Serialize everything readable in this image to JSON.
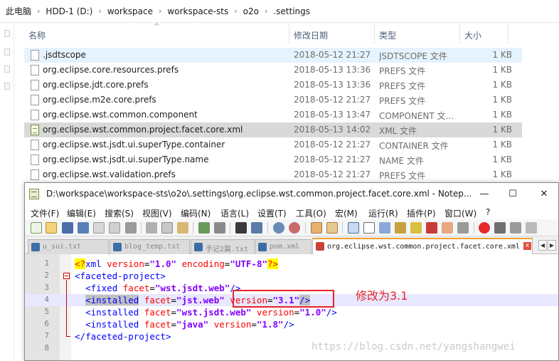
{
  "explorer": {
    "breadcrumb": [
      "此电脑",
      "HDD-1 (D:)",
      "workspace",
      "workspace-sts",
      "o2o",
      ".settings"
    ],
    "columns": {
      "name": "名称",
      "date": "修改日期",
      "type": "类型",
      "size": "大小"
    },
    "files": [
      {
        "name": ".jsdtscope",
        "date": "2018-05-12 21:27",
        "type": "JSDTSCOPE 文件",
        "size": "1 KB"
      },
      {
        "name": "org.eclipse.core.resources.prefs",
        "date": "2018-05-13 13:36",
        "type": "PREFS 文件",
        "size": "1 KB"
      },
      {
        "name": "org.eclipse.jdt.core.prefs",
        "date": "2018-05-13 13:36",
        "type": "PREFS 文件",
        "size": "1 KB"
      },
      {
        "name": "org.eclipse.m2e.core.prefs",
        "date": "2018-05-12 21:27",
        "type": "PREFS 文件",
        "size": "1 KB"
      },
      {
        "name": "org.eclipse.wst.common.component",
        "date": "2018-05-13 13:47",
        "type": "COMPONENT 文...",
        "size": "1 KB"
      },
      {
        "name": "org.eclipse.wst.common.project.facet.core.xml",
        "date": "2018-05-13 14:02",
        "type": "XML 文件",
        "size": "1 KB"
      },
      {
        "name": "org.eclipse.wst.jsdt.ui.superType.container",
        "date": "2018-05-12 21:27",
        "type": "CONTAINER 文件",
        "size": "1 KB"
      },
      {
        "name": "org.eclipse.wst.jsdt.ui.superType.name",
        "date": "2018-05-12 21:27",
        "type": "NAME 文件",
        "size": "1 KB"
      },
      {
        "name": "org.eclipse.wst.validation.prefs",
        "date": "2018-05-12 21:27",
        "type": "PREFS 文件",
        "size": "1 KB"
      }
    ]
  },
  "notepad": {
    "title": "D:\\workspace\\workspace-sts\\o2o\\.settings\\org.eclipse.wst.common.project.facet.core.xml - Notep...",
    "window_buttons": {
      "minimize": "—",
      "maximize": "☐",
      "close": "✕"
    },
    "menu": [
      "文件(F)",
      "编辑(E)",
      "搜索(S)",
      "视图(V)",
      "编码(N)",
      "语言(L)",
      "设置(T)",
      "工具(O)",
      "宏(M)",
      "运行(R)",
      "插件(P)",
      "窗口(W)",
      "?"
    ],
    "tabs": [
      {
        "label": "u_sui.txt",
        "active": false
      },
      {
        "label": "blog_temp.txt",
        "active": false
      },
      {
        "label": "手记2篇.txt",
        "active": false
      },
      {
        "label": "pom.xml",
        "active": false
      },
      {
        "label": "org.eclipse.wst.common.project.facet.core.xml",
        "active": true
      }
    ],
    "tab_scroll": {
      "left": "◀",
      "right": "▶"
    },
    "line_numbers": [
      "1",
      "2",
      "3",
      "4",
      "5",
      "6",
      "7",
      "8"
    ],
    "code": {
      "l1": {
        "pi_open": "<?",
        "tag": "xml",
        "a1": "version",
        "v1": "\"1.0\"",
        "a2": "encoding",
        "v2": "\"UTF-8\"",
        "pi_close": "?>"
      },
      "l2": {
        "open": "<",
        "tag": "faceted-project",
        "close": ">"
      },
      "l3": {
        "open": "<",
        "tag": "fixed",
        "a1": "facet",
        "v1": "\"wst.jsdt.web\"",
        "close": "/>"
      },
      "l4": {
        "open": "<",
        "tag": "installed",
        "a1": "facet",
        "v1": "\"jst.web\"",
        "a2": "version",
        "v2": "\"3.1\"",
        "close": "/>"
      },
      "l5": {
        "open": "<",
        "tag": "installed",
        "a1": "facet",
        "v1": "\"wst.jsdt.web\"",
        "a2": "version",
        "v2": "\"1.0\"",
        "close": "/>"
      },
      "l6": {
        "open": "<",
        "tag": "installed",
        "a1": "facet",
        "v1": "\"java\"",
        "a2": "version",
        "v2": "\"1.8\"",
        "close": "/>"
      },
      "l7": {
        "open": "</",
        "tag": "faceted-project",
        "close": ">"
      }
    }
  },
  "annotation": "修改为3.1",
  "watermark": "https://blog.csdn.net/yangshangwei"
}
